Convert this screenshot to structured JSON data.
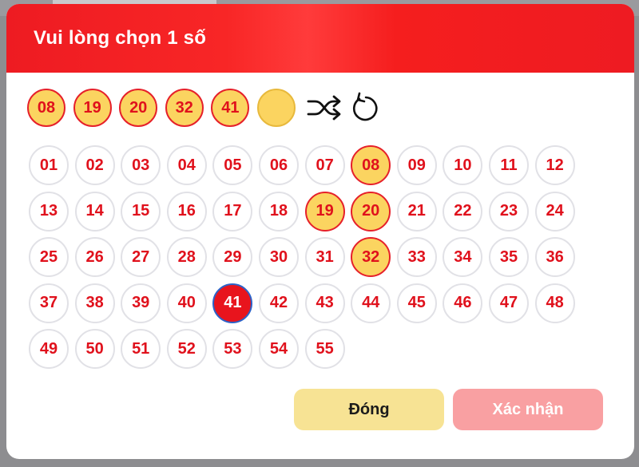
{
  "dialog": {
    "title": "Vui lòng chọn 1 số"
  },
  "selected_slots": [
    "08",
    "19",
    "20",
    "32",
    "41",
    ""
  ],
  "tools": {
    "shuffle_icon": "shuffle-icon",
    "reset_icon": "reset-icon"
  },
  "numbers": [
    "01",
    "02",
    "03",
    "04",
    "05",
    "06",
    "07",
    "08",
    "09",
    "10",
    "11",
    "12",
    "13",
    "14",
    "15",
    "16",
    "17",
    "18",
    "19",
    "20",
    "21",
    "22",
    "23",
    "24",
    "25",
    "26",
    "27",
    "28",
    "29",
    "30",
    "31",
    "32",
    "33",
    "34",
    "35",
    "36",
    "37",
    "38",
    "39",
    "40",
    "41",
    "42",
    "43",
    "44",
    "45",
    "46",
    "47",
    "48",
    "49",
    "50",
    "51",
    "52",
    "53",
    "54",
    "55"
  ],
  "chosen_numbers": [
    "08",
    "19",
    "20",
    "32"
  ],
  "active_number": "41",
  "buttons": {
    "close_label": "Đóng",
    "confirm_label": "Xác nhận"
  },
  "colors": {
    "header_red": "#ee1b22",
    "number_red": "#e0111c",
    "chosen_yellow": "#fbd460",
    "active_outline": "#2c62c8",
    "close_button": "#f7e394",
    "confirm_button": "#f9a0a2"
  }
}
